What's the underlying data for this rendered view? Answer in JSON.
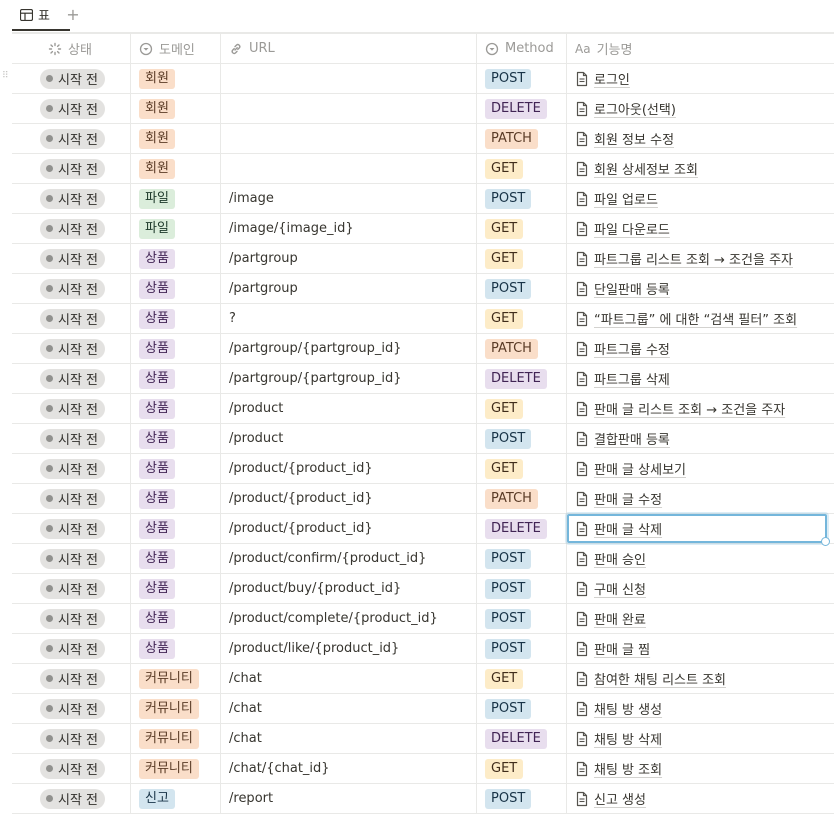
{
  "tabs": [
    {
      "label": "표"
    }
  ],
  "add_view_label": "+",
  "columns": [
    {
      "label": "상태",
      "icon": "status-icon"
    },
    {
      "label": "도메인",
      "icon": "select-icon"
    },
    {
      "label": "URL",
      "icon": "link-icon"
    },
    {
      "label": "Method",
      "icon": "select-icon"
    },
    {
      "label": "기능명",
      "icon": "title-icon",
      "icon_text": "Aa"
    }
  ],
  "colors": {
    "domain": {
      "회원": [
        "#fadec9",
        "#5a3b26"
      ],
      "파일": [
        "#dbeddb",
        "#1c3829"
      ],
      "상품": [
        "#e8deee",
        "#412454"
      ],
      "커뮤니티": [
        "#fadec9",
        "#5a3b26"
      ],
      "신고": [
        "#d3e5ef",
        "#183347"
      ]
    },
    "method": {
      "POST": [
        "#d3e5ef",
        "#183347"
      ],
      "DELETE": [
        "#e8deee",
        "#412454"
      ],
      "PATCH": [
        "#fadec9",
        "#5a3b26"
      ],
      "GET": [
        "#fdecc8",
        "#402c1b"
      ]
    }
  },
  "rows": [
    {
      "status": "시작 전",
      "domain": "회원",
      "url": "",
      "method": "POST",
      "name": "로그인"
    },
    {
      "status": "시작 전",
      "domain": "회원",
      "url": "",
      "method": "DELETE",
      "name": "로그아웃(선택)"
    },
    {
      "status": "시작 전",
      "domain": "회원",
      "url": "",
      "method": "PATCH",
      "name": "회원 정보 수정"
    },
    {
      "status": "시작 전",
      "domain": "회원",
      "url": "",
      "method": "GET",
      "name": "회원 상세정보 조회"
    },
    {
      "status": "시작 전",
      "domain": "파일",
      "url": "/image",
      "method": "POST",
      "name": "파일 업로드"
    },
    {
      "status": "시작 전",
      "domain": "파일",
      "url": "/image/{image_id}",
      "method": "GET",
      "name": "파일 다운로드"
    },
    {
      "status": "시작 전",
      "domain": "상품",
      "url": "/partgroup",
      "method": "GET",
      "name": "파트그룹 리스트 조회 → 조건을 주자"
    },
    {
      "status": "시작 전",
      "domain": "상품",
      "url": "/partgroup",
      "method": "POST",
      "name": "단일판매 등록"
    },
    {
      "status": "시작 전",
      "domain": "상품",
      "url": "?",
      "method": "GET",
      "name": "“파트그룹” 에 대한 “검색 필터” 조회"
    },
    {
      "status": "시작 전",
      "domain": "상품",
      "url": "/partgroup/{partgroup_id}",
      "method": "PATCH",
      "name": "파트그룹 수정"
    },
    {
      "status": "시작 전",
      "domain": "상품",
      "url": "/partgroup/{partgroup_id}",
      "method": "DELETE",
      "name": "파트그룹 삭제"
    },
    {
      "status": "시작 전",
      "domain": "상품",
      "url": "/product",
      "method": "GET",
      "name": "판매 글 리스트 조회 → 조건을 주자"
    },
    {
      "status": "시작 전",
      "domain": "상품",
      "url": "/product",
      "method": "POST",
      "name": "결합판매 등록"
    },
    {
      "status": "시작 전",
      "domain": "상품",
      "url": "/product/{product_id}",
      "method": "GET",
      "name": "판매 글 상세보기"
    },
    {
      "status": "시작 전",
      "domain": "상품",
      "url": "/product/{product_id}",
      "method": "PATCH",
      "name": "판매 글 수정"
    },
    {
      "status": "시작 전",
      "domain": "상품",
      "url": "/product/{product_id}",
      "method": "DELETE",
      "name": "판매 글 삭제",
      "selected": true
    },
    {
      "status": "시작 전",
      "domain": "상품",
      "url": "/product/confirm/{product_id}",
      "method": "POST",
      "name": "판매 승인"
    },
    {
      "status": "시작 전",
      "domain": "상품",
      "url": "/product/buy/{product_id}",
      "method": "POST",
      "name": "구매 신청"
    },
    {
      "status": "시작 전",
      "domain": "상품",
      "url": "/product/complete/{product_id}",
      "method": "POST",
      "name": "판매 완료"
    },
    {
      "status": "시작 전",
      "domain": "상품",
      "url": "/product/like/{product_id}",
      "method": "POST",
      "name": "판매 글 찜"
    },
    {
      "status": "시작 전",
      "domain": "커뮤니티",
      "url": "/chat",
      "method": "GET",
      "name": "참여한 채팅 리스트 조회"
    },
    {
      "status": "시작 전",
      "domain": "커뮤니티",
      "url": "/chat",
      "method": "POST",
      "name": "채팅 방 생성"
    },
    {
      "status": "시작 전",
      "domain": "커뮤니티",
      "url": "/chat",
      "method": "DELETE",
      "name": "채팅 방 삭제"
    },
    {
      "status": "시작 전",
      "domain": "커뮤니티",
      "url": "/chat/{chat_id}",
      "method": "GET",
      "name": "채팅 방 조회"
    },
    {
      "status": "시작 전",
      "domain": "신고",
      "url": "/report",
      "method": "POST",
      "name": "신고 생성"
    }
  ]
}
